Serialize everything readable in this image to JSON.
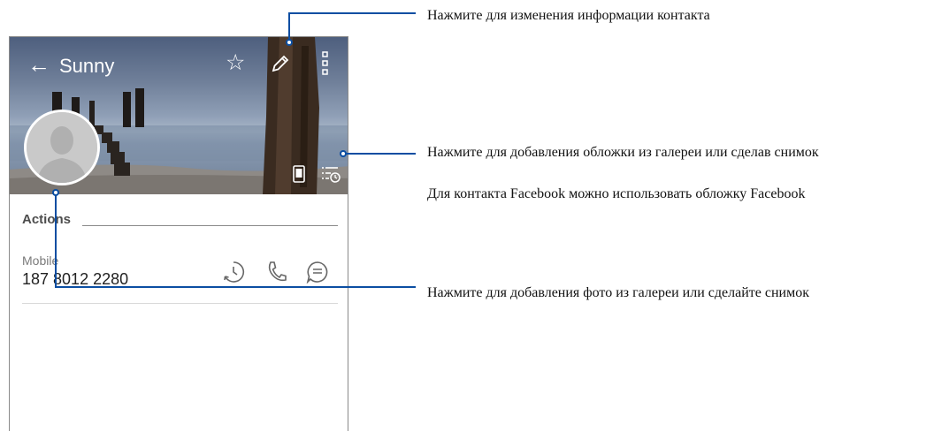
{
  "contact": {
    "name": "Sunny",
    "actions_heading": "Actions",
    "phone_label": "Mobile",
    "phone_number": "187 8012 2280"
  },
  "icons": {
    "back": "←",
    "star": "☆"
  },
  "callouts": {
    "edit": "Нажмите для изменения информации контакта",
    "cover": "Нажмите для добавления обложки из галереи или сделав снимок",
    "facebook": "Для контакта Facebook можно использовать обложку Facebook",
    "photo": "Нажмите для добавления фото из галереи или сделайте снимок"
  },
  "colors": {
    "callout": "#0b4ea2"
  }
}
